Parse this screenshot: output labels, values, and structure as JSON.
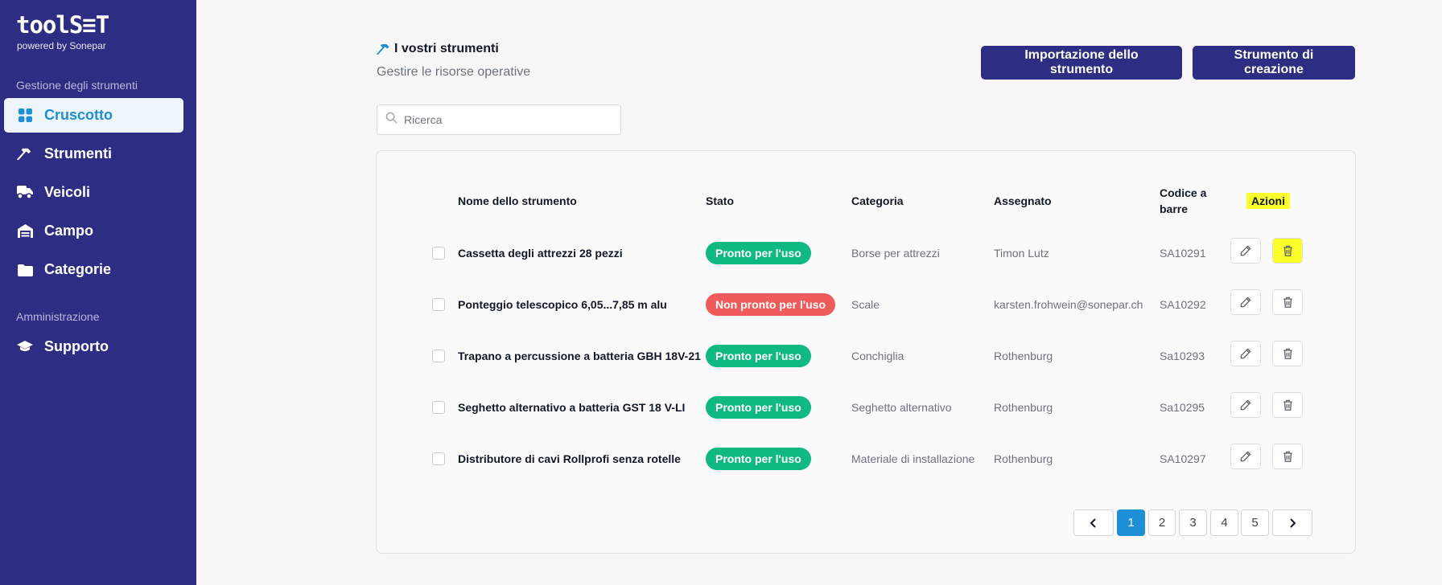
{
  "brand": {
    "logo": "toolS≡T",
    "tagline": "powered by Sonepar"
  },
  "sidebar": {
    "section1": "Gestione degli strumenti",
    "items": [
      {
        "label": "Cruscotto",
        "icon": "dashboard-icon",
        "active": true
      },
      {
        "label": "Strumenti",
        "icon": "hammer-icon"
      },
      {
        "label": "Veicoli",
        "icon": "truck-icon"
      },
      {
        "label": "Campo",
        "icon": "warehouse-icon"
      },
      {
        "label": "Categorie",
        "icon": "folder-icon"
      }
    ],
    "section2": "Amministrazione",
    "admin_items": [
      {
        "label": "Supporto",
        "icon": "graduation-cap-icon"
      }
    ]
  },
  "header": {
    "title": "I vostri strumenti",
    "subtitle": "Gestire le risorse operative",
    "import_label": "Importazione dello strumento",
    "create_label": "Strumento di creazione"
  },
  "search": {
    "placeholder": "Ricerca"
  },
  "table": {
    "columns": {
      "name": "Nome dello strumento",
      "status": "Stato",
      "category": "Categoria",
      "assigned": "Assegnato",
      "barcode": "Codice a barre",
      "actions": "Azioni"
    },
    "rows": [
      {
        "name": "Cassetta degli attrezzi 28 pezzi",
        "status": "Pronto per l'uso",
        "ready": true,
        "category": "Borse per attrezzi",
        "assigned": "Timon Lutz",
        "barcode": "SA10291"
      },
      {
        "name": "Ponteggio telescopico 6,05...7,85 m alu",
        "status": "Non pronto per l'uso",
        "ready": false,
        "category": "Scale",
        "assigned": "karsten.frohwein@sonepar.ch",
        "barcode": "SA10292"
      },
      {
        "name": "Trapano a percussione a batteria GBH 18V-21",
        "status": "Pronto per l'uso",
        "ready": true,
        "category": "Conchiglia",
        "assigned": "Rothenburg",
        "barcode": "Sa10293"
      },
      {
        "name": "Seghetto alternativo a batteria GST 18 V-LI",
        "status": "Pronto per l'uso",
        "ready": true,
        "category": "Seghetto alternativo",
        "assigned": "Rothenburg",
        "barcode": "Sa10295"
      },
      {
        "name": "Distributore di cavi Rollprofi senza rotelle",
        "status": "Pronto per l'uso",
        "ready": true,
        "category": "Materiale di installazione",
        "assigned": "Rothenburg",
        "barcode": "SA10297"
      }
    ]
  },
  "pagination": {
    "pages": [
      "1",
      "2",
      "3",
      "4",
      "5"
    ],
    "current": "1"
  },
  "colors": {
    "sidebar": "#2e2d84",
    "accent": "#1d8fd6",
    "ready": "#10b981",
    "not_ready": "#ef5b5b",
    "highlight": "#fbff2a"
  }
}
